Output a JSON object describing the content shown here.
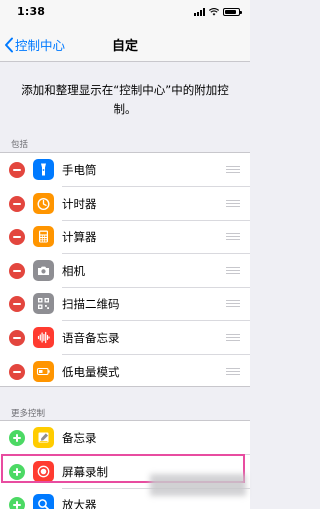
{
  "status_bar": {
    "time": "1:38"
  },
  "nav": {
    "back_label": "控制中心",
    "title": "自定"
  },
  "description": "添加和整理显示在“控制中心”中的附加控制。",
  "sections": {
    "included": {
      "header": "包括",
      "items": [
        {
          "label": "手电筒",
          "icon": "flashlight-icon",
          "color": "#007aff"
        },
        {
          "label": "计时器",
          "icon": "timer-icon",
          "color": "#ff9500"
        },
        {
          "label": "计算器",
          "icon": "calculator-icon",
          "color": "#ff9500"
        },
        {
          "label": "相机",
          "icon": "camera-icon",
          "color": "#8e8e93"
        },
        {
          "label": "扫描二维码",
          "icon": "qr-code-icon",
          "color": "#8e8e93"
        },
        {
          "label": "语音备忘录",
          "icon": "voice-memos-icon",
          "color": "#ff3b30"
        },
        {
          "label": "低电量模式",
          "icon": "battery-icon",
          "color": "#ff9500"
        }
      ]
    },
    "more": {
      "header": "更多控制",
      "items": [
        {
          "label": "备忘录",
          "icon": "notes-icon",
          "color": "#ffcc00"
        },
        {
          "label": "屏幕录制",
          "icon": "screen-recording-icon",
          "color": "#ff3b30"
        },
        {
          "label": "放大器",
          "icon": "magnifier-icon",
          "color": "#007aff"
        }
      ]
    }
  },
  "colors": {
    "accent": "#007aff",
    "remove": "#e3463e",
    "add": "#4cd964",
    "highlight": "#e84ca0"
  }
}
